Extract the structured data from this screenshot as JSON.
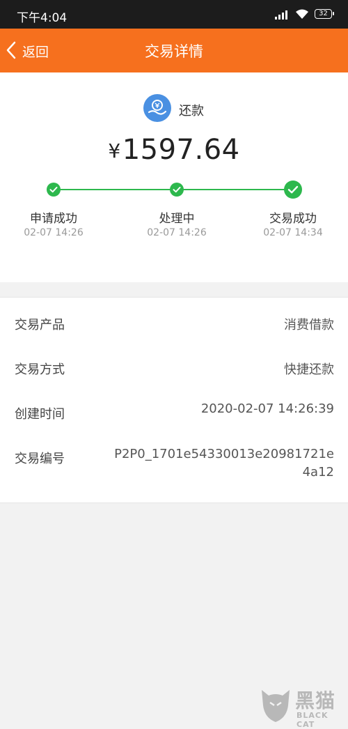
{
  "status_bar": {
    "time": "下午4:04",
    "battery": "32",
    "icons": [
      "signal-icon",
      "wifi-icon",
      "battery-icon"
    ]
  },
  "nav": {
    "back_label": "返回",
    "title": "交易详情"
  },
  "summary": {
    "type_icon": "yuan-hand-icon",
    "type_label": "还款",
    "currency": "¥",
    "amount": "1597.64",
    "progress_color": "#2db84d",
    "steps": [
      {
        "label": "申请成功",
        "time": "02-07 14:26"
      },
      {
        "label": "处理中",
        "time": "02-07 14:26"
      },
      {
        "label": "交易成功",
        "time": "02-07 14:34"
      }
    ]
  },
  "details": [
    {
      "label": "交易产品",
      "value": "消费借款"
    },
    {
      "label": "交易方式",
      "value": "快捷还款"
    },
    {
      "label": "创建时间",
      "value": "2020-02-07 14:26:39"
    },
    {
      "label": "交易编号",
      "value": "P2P0_1701e54330013e20981721e4a12"
    }
  ],
  "watermark": {
    "cn": "黑猫",
    "en": "BLACK CAT"
  },
  "colors": {
    "accent": "#f6701e",
    "success": "#2db84d",
    "icon_blue": "#4a90e2"
  }
}
